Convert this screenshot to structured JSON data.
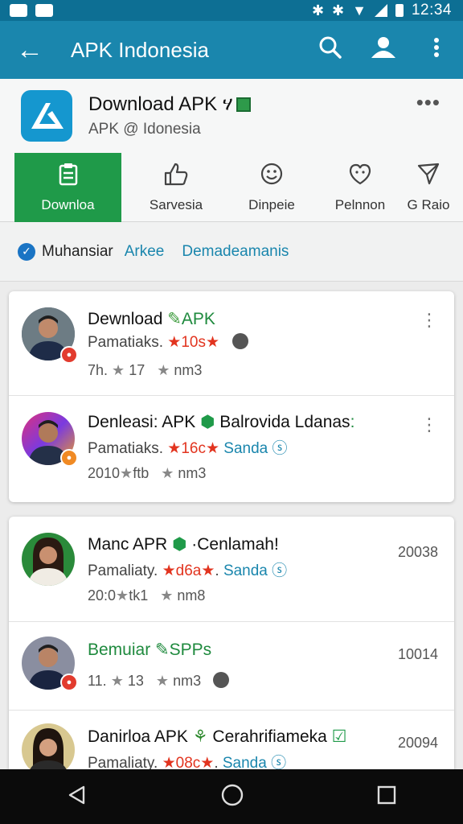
{
  "status_bar": {
    "time": "12:34"
  },
  "app_bar": {
    "title": "APK Indonesia"
  },
  "app_header": {
    "name": "Download APK",
    "subtitle": "APK @ Idonesia"
  },
  "tabs": [
    {
      "label": "Downloa",
      "icon": "clipboard-icon"
    },
    {
      "label": "Sarvesia",
      "icon": "thumbs-up-icon"
    },
    {
      "label": "Dinpeie",
      "icon": "smiley-icon"
    },
    {
      "label": "Pelnnon",
      "icon": "heart-chat-icon"
    },
    {
      "label": "G Raio",
      "icon": "send-icon"
    }
  ],
  "filters": {
    "label": "Muhansiar",
    "links": [
      "Arkee",
      "Demadeamanis"
    ]
  },
  "card1": [
    {
      "title": "Dewnload",
      "title_suffix": "APK",
      "sub_prefix": "Pamatiaks",
      "sub_rating": "10s",
      "meta_left": "7h.",
      "meta_mid": "17",
      "meta_right": "nm3"
    },
    {
      "title": "Denleasi: APK",
      "title_suffix": "Balrovida Ldanas",
      "sub_prefix": "Pamatiaks",
      "sub_rating": "16c",
      "sub_link": "Sanda",
      "meta_left": "2010",
      "meta_mid": "ftb",
      "meta_right": "nm3"
    }
  ],
  "card2": [
    {
      "title": "Manc APR",
      "title_suffix": "Cenlamah!",
      "sub_prefix": "Pamaliaty",
      "sub_rating": "d6a",
      "sub_link": "Sanda",
      "meta_left": "20:0",
      "meta_mid": "tk1",
      "meta_right": "nm8",
      "num": "20038"
    },
    {
      "title": "Bemuiar",
      "title_suffix": "SPPs",
      "meta_left": "11.",
      "meta_mid": "13",
      "meta_right": "nm3",
      "num": "10014"
    },
    {
      "title": "Danirloa APK",
      "title_suffix": "Cerahrifiameka",
      "sub_prefix": "Pamaliaty",
      "sub_rating": "08c",
      "sub_link": "Sanda",
      "num": "20094"
    }
  ],
  "colors": {
    "status_bar": "#0d6f94",
    "app_bar": "#1a86ad",
    "active_tab": "#1f9a49",
    "link": "#1a86ad",
    "star": "#e2341f"
  }
}
